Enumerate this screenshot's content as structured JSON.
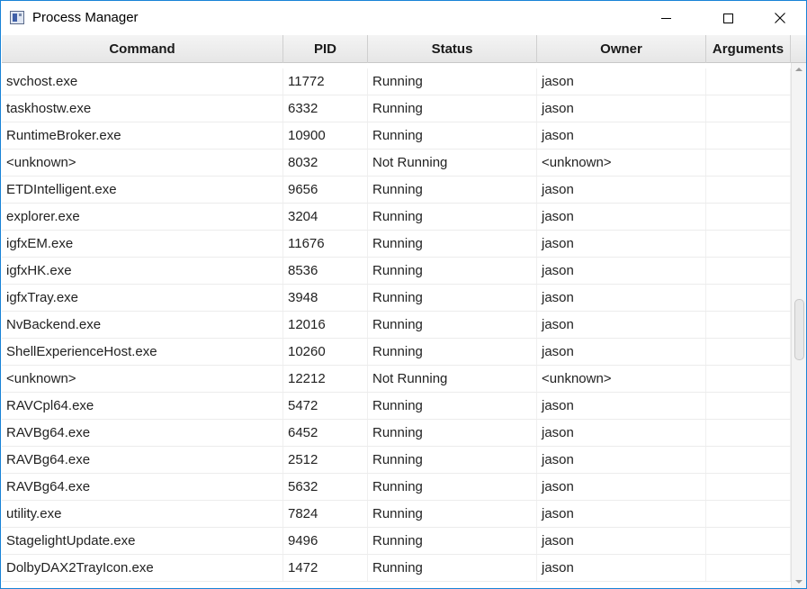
{
  "window": {
    "title": "Process Manager",
    "icon": "app-window-icon",
    "controls": {
      "minimize_icon": "minimize-icon",
      "maximize_icon": "maximize-icon",
      "close_icon": "close-icon",
      "close_glyph": "✕"
    }
  },
  "table": {
    "columns": [
      "Command",
      "PID",
      "Status",
      "Owner",
      "Arguments"
    ],
    "rows": [
      {
        "command": "svchost.exe",
        "pid": "11772",
        "status": "Running",
        "owner": "jason",
        "arguments": ""
      },
      {
        "command": "taskhostw.exe",
        "pid": "6332",
        "status": "Running",
        "owner": "jason",
        "arguments": ""
      },
      {
        "command": "RuntimeBroker.exe",
        "pid": "10900",
        "status": "Running",
        "owner": "jason",
        "arguments": ""
      },
      {
        "command": "<unknown>",
        "pid": "8032",
        "status": "Not Running",
        "owner": "<unknown>",
        "arguments": ""
      },
      {
        "command": "ETDIntelligent.exe",
        "pid": "9656",
        "status": "Running",
        "owner": "jason",
        "arguments": ""
      },
      {
        "command": "explorer.exe",
        "pid": "3204",
        "status": "Running",
        "owner": "jason",
        "arguments": ""
      },
      {
        "command": "igfxEM.exe",
        "pid": "11676",
        "status": "Running",
        "owner": "jason",
        "arguments": ""
      },
      {
        "command": "igfxHK.exe",
        "pid": "8536",
        "status": "Running",
        "owner": "jason",
        "arguments": ""
      },
      {
        "command": "igfxTray.exe",
        "pid": "3948",
        "status": "Running",
        "owner": "jason",
        "arguments": ""
      },
      {
        "command": "NvBackend.exe",
        "pid": "12016",
        "status": "Running",
        "owner": "jason",
        "arguments": ""
      },
      {
        "command": "ShellExperienceHost.exe",
        "pid": "10260",
        "status": "Running",
        "owner": "jason",
        "arguments": ""
      },
      {
        "command": "<unknown>",
        "pid": "12212",
        "status": "Not Running",
        "owner": "<unknown>",
        "arguments": ""
      },
      {
        "command": "RAVCpl64.exe",
        "pid": "5472",
        "status": "Running",
        "owner": "jason",
        "arguments": ""
      },
      {
        "command": "RAVBg64.exe",
        "pid": "6452",
        "status": "Running",
        "owner": "jason",
        "arguments": ""
      },
      {
        "command": "RAVBg64.exe",
        "pid": "2512",
        "status": "Running",
        "owner": "jason",
        "arguments": ""
      },
      {
        "command": "RAVBg64.exe",
        "pid": "5632",
        "status": "Running",
        "owner": "jason",
        "arguments": ""
      },
      {
        "command": "utility.exe",
        "pid": "7824",
        "status": "Running",
        "owner": "jason",
        "arguments": ""
      },
      {
        "command": "StagelightUpdate.exe",
        "pid": "9496",
        "status": "Running",
        "owner": "jason",
        "arguments": ""
      },
      {
        "command": "DolbyDAX2TrayIcon.exe",
        "pid": "1472",
        "status": "Running",
        "owner": "jason",
        "arguments": ""
      }
    ]
  },
  "scrollbar": {
    "up_icon": "scroll-up-arrow-icon",
    "down_icon": "scroll-down-arrow-icon"
  },
  "colors": {
    "window_border": "#1883d7",
    "header_bg": "#ececec",
    "text": "#222222"
  }
}
